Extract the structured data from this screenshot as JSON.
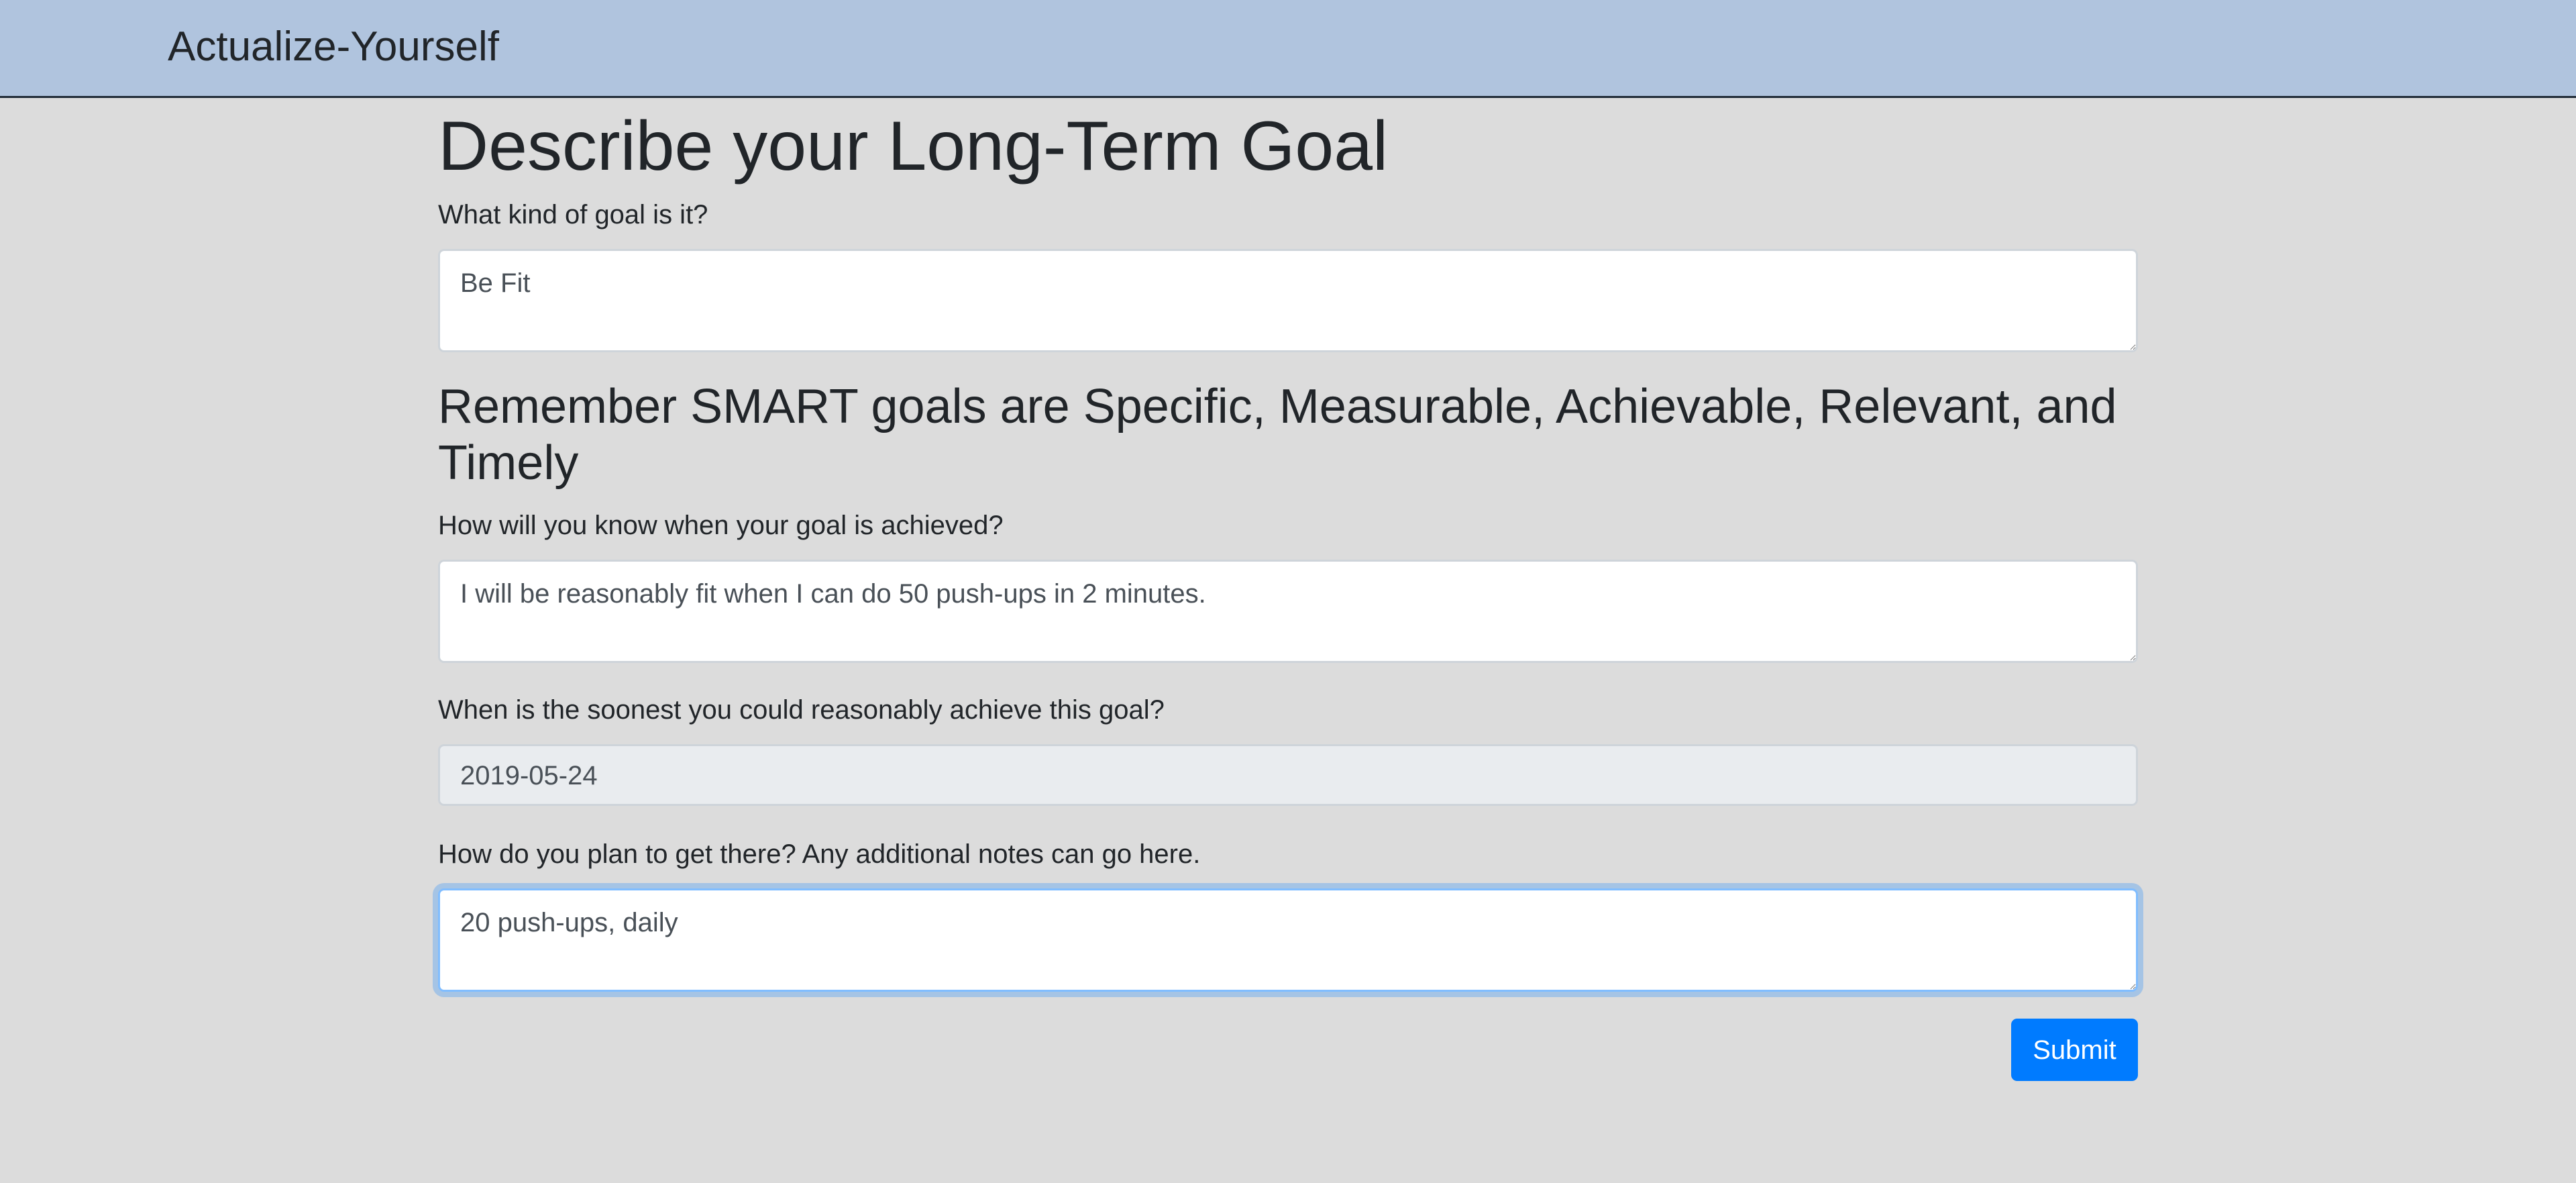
{
  "navbar": {
    "brand": "Actualize-Yourself"
  },
  "page": {
    "title": "Describe your Long-Term Goal",
    "smart_heading": "Remember SMART goals are Specific, Measurable, Achievable, Relevant, and Timely"
  },
  "form": {
    "goal_kind": {
      "label": "What kind of goal is it?",
      "value": "Be Fit"
    },
    "achieved": {
      "label": "How will you know when your goal is achieved?",
      "value": "I will be reasonably fit when I can do 50 push-ups in 2 minutes."
    },
    "soonest_date": {
      "label": "When is the soonest you could reasonably achieve this goal?",
      "value": "2019-05-24"
    },
    "plan_notes": {
      "label": "How do you plan to get there? Any additional notes can go here.",
      "value": "20 push-ups, daily"
    },
    "submit_label": "Submit"
  },
  "colors": {
    "navbar_bg": "#b0c4de",
    "page_bg": "#dcdcdc",
    "primary": "#007bff",
    "focus_ring": "#80bdff"
  }
}
